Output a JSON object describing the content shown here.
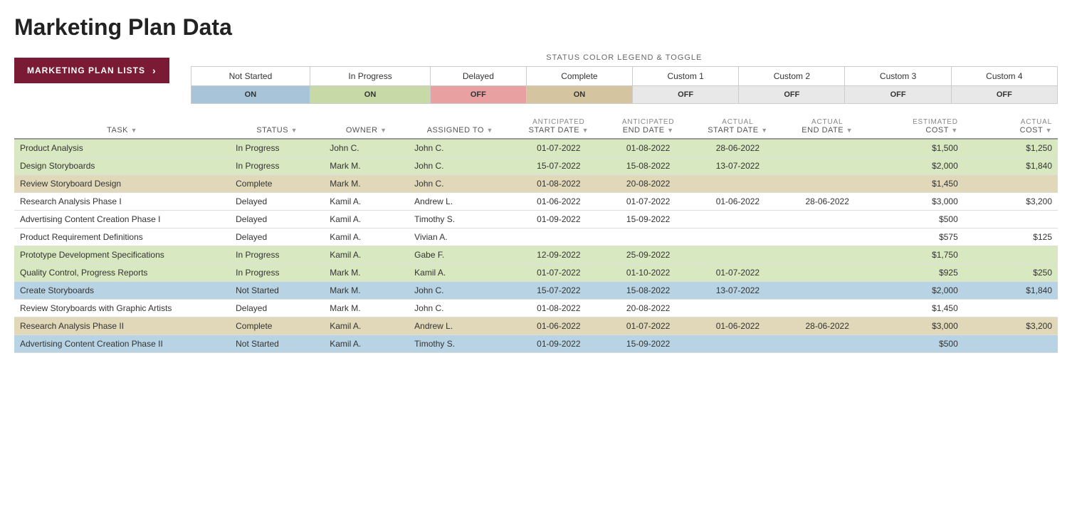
{
  "page": {
    "title": "Marketing Plan Data"
  },
  "nav": {
    "button_label": "MARKETING PLAN LISTS",
    "chevron": "›"
  },
  "legend": {
    "title": "STATUS COLOR LEGEND & TOGGLE",
    "statuses": [
      {
        "label": "Not Started",
        "toggle": "ON",
        "label_class": "legend-not-started",
        "toggle_class": "toggle-on"
      },
      {
        "label": "In Progress",
        "toggle": "ON",
        "label_class": "legend-in-progress",
        "toggle_class": "toggle-on-green"
      },
      {
        "label": "Delayed",
        "toggle": "OFF",
        "label_class": "legend-delayed",
        "toggle_class": "toggle-off-pink"
      },
      {
        "label": "Complete",
        "toggle": "ON",
        "label_class": "legend-complete",
        "toggle_class": "toggle-on-tan"
      },
      {
        "label": "Custom 1",
        "toggle": "OFF",
        "label_class": "legend-custom1",
        "toggle_class": "toggle-off"
      },
      {
        "label": "Custom 2",
        "toggle": "OFF",
        "label_class": "legend-custom2",
        "toggle_class": "toggle-off"
      },
      {
        "label": "Custom 3",
        "toggle": "OFF",
        "label_class": "legend-custom3",
        "toggle_class": "toggle-off"
      },
      {
        "label": "Custom 4",
        "toggle": "OFF",
        "label_class": "legend-custom4",
        "toggle_class": "toggle-off"
      }
    ]
  },
  "table": {
    "columns": [
      {
        "id": "task",
        "line1": "",
        "line2": "TASK"
      },
      {
        "id": "status",
        "line1": "",
        "line2": "STATUS"
      },
      {
        "id": "owner",
        "line1": "",
        "line2": "OWNER"
      },
      {
        "id": "assigned",
        "line1": "",
        "line2": "ASSIGNED TO"
      },
      {
        "id": "ant_start",
        "line1": "ANTICIPATED",
        "line2": "START DATE"
      },
      {
        "id": "ant_end",
        "line1": "ANTICIPATED",
        "line2": "END DATE"
      },
      {
        "id": "act_start",
        "line1": "ACTUAL",
        "line2": "START DATE"
      },
      {
        "id": "act_end",
        "line1": "ACTUAL",
        "line2": "END DATE"
      },
      {
        "id": "est_cost",
        "line1": "ESTIMATED",
        "line2": "COST"
      },
      {
        "id": "act_cost",
        "line1": "ACTUAL",
        "line2": "COST"
      }
    ],
    "rows": [
      {
        "task": "Product Analysis",
        "status": "In Progress",
        "owner": "John C.",
        "assigned": "John C.",
        "ant_start": "01-07-2022",
        "ant_end": "01-08-2022",
        "act_start": "28-06-2022",
        "act_end": "",
        "est_cost": "$1,500",
        "act_cost": "$1,250",
        "row_class": "row-in-progress",
        "status_class": "status-in-progress"
      },
      {
        "task": "Design Storyboards",
        "status": "In Progress",
        "owner": "Mark M.",
        "assigned": "John C.",
        "ant_start": "15-07-2022",
        "ant_end": "15-08-2022",
        "act_start": "13-07-2022",
        "act_end": "",
        "est_cost": "$2,000",
        "act_cost": "$1,840",
        "row_class": "row-in-progress",
        "status_class": "status-in-progress"
      },
      {
        "task": "Review Storyboard Design",
        "status": "Complete",
        "owner": "Mark M.",
        "assigned": "John C.",
        "ant_start": "01-08-2022",
        "ant_end": "20-08-2022",
        "act_start": "",
        "act_end": "",
        "est_cost": "$1,450",
        "act_cost": "",
        "row_class": "row-complete",
        "status_class": "status-complete"
      },
      {
        "task": "Research Analysis Phase I",
        "status": "Delayed",
        "owner": "Kamil A.",
        "assigned": "Andrew L.",
        "ant_start": "01-06-2022",
        "ant_end": "01-07-2022",
        "act_start": "01-06-2022",
        "act_end": "28-06-2022",
        "est_cost": "$3,000",
        "act_cost": "$3,200",
        "row_class": "row-delayed",
        "status_class": "status-delayed"
      },
      {
        "task": "Advertising Content Creation Phase I",
        "status": "Delayed",
        "owner": "Kamil A.",
        "assigned": "Timothy S.",
        "ant_start": "01-09-2022",
        "ant_end": "15-09-2022",
        "act_start": "",
        "act_end": "",
        "est_cost": "$500",
        "act_cost": "",
        "row_class": "row-delayed",
        "status_class": "status-delayed"
      },
      {
        "task": "Product Requirement Definitions",
        "status": "Delayed",
        "owner": "Kamil A.",
        "assigned": "Vivian A.",
        "ant_start": "",
        "ant_end": "",
        "act_start": "",
        "act_end": "",
        "est_cost": "$575",
        "act_cost": "$125",
        "row_class": "row-delayed",
        "status_class": "status-delayed"
      },
      {
        "task": "Prototype Development Specifications",
        "status": "In Progress",
        "owner": "Kamil A.",
        "assigned": "Gabe F.",
        "ant_start": "12-09-2022",
        "ant_end": "25-09-2022",
        "act_start": "",
        "act_end": "",
        "est_cost": "$1,750",
        "act_cost": "",
        "row_class": "row-in-progress",
        "status_class": "status-in-progress"
      },
      {
        "task": "Quality Control, Progress Reports",
        "status": "In Progress",
        "owner": "Mark M.",
        "assigned": "Kamil A.",
        "ant_start": "01-07-2022",
        "ant_end": "01-10-2022",
        "act_start": "01-07-2022",
        "act_end": "",
        "est_cost": "$925",
        "act_cost": "$250",
        "row_class": "row-in-progress",
        "status_class": "status-in-progress"
      },
      {
        "task": "Create Storyboards",
        "status": "Not Started",
        "owner": "Mark M.",
        "assigned": "John C.",
        "ant_start": "15-07-2022",
        "ant_end": "15-08-2022",
        "act_start": "13-07-2022",
        "act_end": "",
        "est_cost": "$2,000",
        "act_cost": "$1,840",
        "row_class": "row-not-started",
        "status_class": "status-not-started"
      },
      {
        "task": "Review Storyboards with Graphic Artists",
        "status": "Delayed",
        "owner": "Mark M.",
        "assigned": "John C.",
        "ant_start": "01-08-2022",
        "ant_end": "20-08-2022",
        "act_start": "",
        "act_end": "",
        "est_cost": "$1,450",
        "act_cost": "",
        "row_class": "row-delayed",
        "status_class": "status-delayed"
      },
      {
        "task": "Research Analysis Phase II",
        "status": "Complete",
        "owner": "Kamil A.",
        "assigned": "Andrew L.",
        "ant_start": "01-06-2022",
        "ant_end": "01-07-2022",
        "act_start": "01-06-2022",
        "act_end": "28-06-2022",
        "est_cost": "$3,000",
        "act_cost": "$3,200",
        "row_class": "row-complete",
        "status_class": "status-complete"
      },
      {
        "task": "Advertising Content Creation Phase II",
        "status": "Not Started",
        "owner": "Kamil A.",
        "assigned": "Timothy S.",
        "ant_start": "01-09-2022",
        "ant_end": "15-09-2022",
        "act_start": "",
        "act_end": "",
        "est_cost": "$500",
        "act_cost": "",
        "row_class": "row-not-started",
        "status_class": "status-not-started"
      }
    ]
  }
}
